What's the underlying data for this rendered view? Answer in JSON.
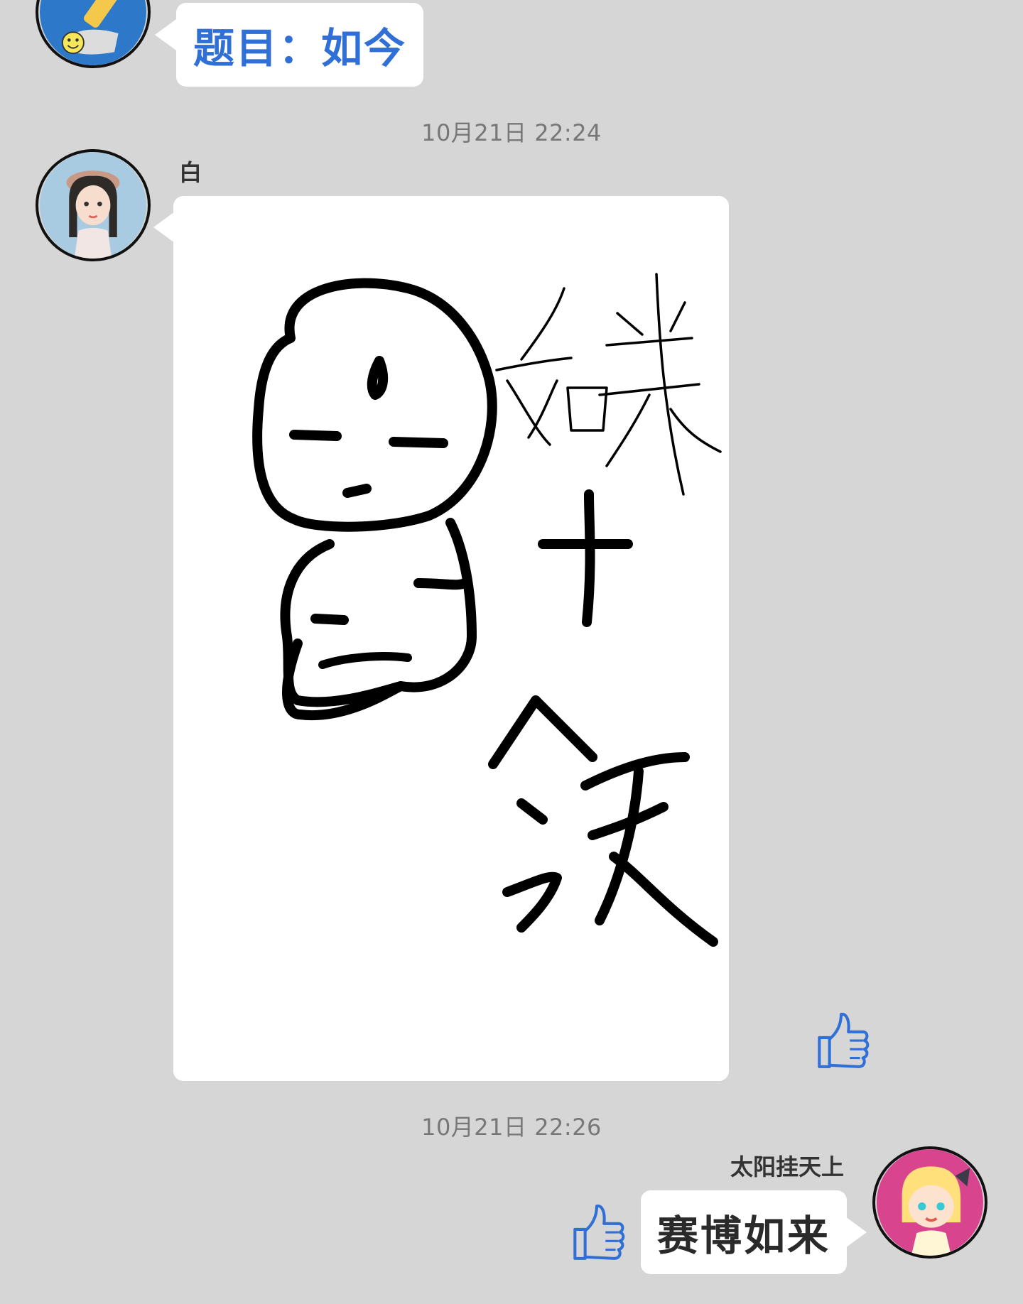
{
  "messages": [
    {
      "prompt_text": "题目：如今"
    },
    {
      "timestamp": "10月21日  22:24",
      "sender_name": "白",
      "drawing": {
        "handwritten_chars": [
          "如来",
          "+",
          "今天"
        ]
      }
    },
    {
      "timestamp": "10月21日  22:26",
      "sender_name": "太阳挂天上",
      "reply_text": "赛博如来"
    }
  ],
  "icons": {
    "like": "thumbs-up-icon",
    "avatars": [
      "drawing-bot-avatar",
      "girl-avatar",
      "anime-avatar"
    ]
  },
  "colors": {
    "background": "#d6d6d6",
    "bubble": "#ffffff",
    "prompt_text": "#2f6fd6",
    "timestamp": "#777777",
    "like_icon": "#2f6fd6"
  }
}
